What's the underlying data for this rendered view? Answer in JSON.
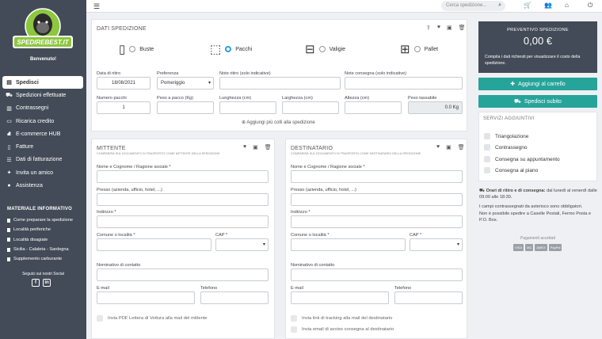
{
  "sidebar": {
    "logo_text": "SPEDIREBEST.IT",
    "welcome": "Benvenuto!",
    "menu": [
      {
        "label": "Spedisci",
        "icon": "ship-icon"
      },
      {
        "label": "Spedizioni effettuate",
        "icon": "truck-icon"
      },
      {
        "label": "Contrassegni",
        "icon": "money-icon"
      },
      {
        "label": "Ricarica credito",
        "icon": "card-icon"
      },
      {
        "label": "E-commerce HUB",
        "icon": "cart-icon"
      },
      {
        "label": "Fatture",
        "icon": "document-icon"
      },
      {
        "label": "Dati di fatturazione",
        "icon": "list-icon"
      },
      {
        "label": "Invita un amico",
        "icon": "gift-icon"
      },
      {
        "label": "Assistenza",
        "icon": "help-icon"
      }
    ],
    "materiale_title": "MATERIALE INFORMATIVO",
    "materiale": [
      "Come preparare la spedizione",
      "Località periferiche",
      "Località disagiate",
      "Sicilia - Calabria - Sardegna",
      "Supplemento carburante"
    ],
    "social_title": "Seguici sui nostri Social"
  },
  "topbar": {
    "search_placeholder": "Cerca spedizione..."
  },
  "dati": {
    "title": "DATI SPEDIZIONE",
    "packages": [
      {
        "label": "Buste",
        "selected": false
      },
      {
        "label": "Pacchi",
        "selected": true
      },
      {
        "label": "Valigie",
        "selected": false
      },
      {
        "label": "Pallet",
        "selected": false
      }
    ],
    "data_ritiro_label": "Data di ritiro",
    "data_ritiro": "18/08/2021",
    "preferenza_label": "Preferenza",
    "preferenza": "Pomeriggio",
    "note_ritiro_label": "Note ritiro (solo indicative)",
    "note_consegna_label": "Note consegna (solo indicative)",
    "numero_pacchi_label": "Numero pacchi",
    "numero_pacchi": "1",
    "peso_label": "Peso a pacco (Kg)",
    "lunghezza_label": "Lunghezza (cm)",
    "larghezza_label": "Larghezza (cm)",
    "altezza_label": "Altezza (cm)",
    "peso_tassabile_label": "Peso tassabile",
    "peso_tassabile": "0.0 Kg",
    "add_more": "Aggiungi più colli alla spedizione"
  },
  "mittente": {
    "title": "MITTENTE",
    "subtitle": "COMPARIRÀ SUL DOCUMENTO DI TRASPORTO COME MITTENTE DELLA SPEDIZIONE",
    "nome": "Nome e Cognome / Ragione sociale *",
    "presso": "Presso (azienda, ufficio, hotel, ...)",
    "indirizzo": "Indirizzo *",
    "comune": "Comune o località *",
    "cap": "CAP *",
    "nominativo": "Nominativo di contatto",
    "email": "E-mail",
    "telefono": "Telefono",
    "check1": "Invia PDF Lettera di Vettura alla mail del mittente"
  },
  "destinatario": {
    "title": "DESTINATARIO",
    "subtitle": "COMPARIRÀ SUL DOCUMENTO DI TRASPORTO COME DESTINATARIO DELLA SPEDIZIONE",
    "nome": "Nome e Cognome / Ragione sociale *",
    "presso": "Presso (azienda, ufficio, hotel, ...)",
    "indirizzo": "Indirizzo *",
    "comune": "Comune o località *",
    "cap": "CAP *",
    "nominativo": "Nominativo di contatto",
    "email": "E-mail",
    "telefono": "Telefono",
    "check1": "Invia link di tracking alla mail del destinatario",
    "check2": "Invia email di avviso consegna al destinatario"
  },
  "preventivo": {
    "title": "PREVENTIVO SPEDIZIONE",
    "value": "0,00 €",
    "desc": "Compila i dati richiesti per visualizzare il costo della spedizione."
  },
  "buttons": {
    "add_cart": "Aggiungi al carrello",
    "ship_now": "Spedisci subito"
  },
  "servizi": {
    "title": "SERVIZI AGGIUNTIVI",
    "items": [
      "Triangolazione",
      "Contrassegno",
      "Consegna su appuntamento",
      "Consegna al piano"
    ]
  },
  "info": {
    "orari_bold": "Orari di ritiro e di consegna:",
    "orari": " dal lunedì al venerdì dalle 09:00 alle 18:30.",
    "obbligatori": "I campi contrassegnati da asterisco sono obbligatori.",
    "caselle": "Non è possibile spedire a Caselle Postali, Fermo Posta e P.O. Box."
  },
  "pagamenti": {
    "title": "Pagamenti accettati",
    "methods": [
      "VISA",
      "MC",
      "AMEX",
      "PayPal"
    ]
  },
  "colors": {
    "sidebar": "#424b57",
    "accent": "#26a49a",
    "radio": "#2d9fd9"
  }
}
